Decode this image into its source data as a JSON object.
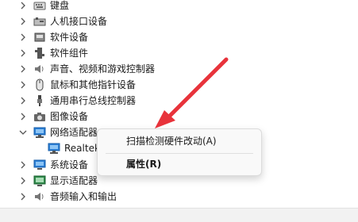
{
  "tree": {
    "items": [
      {
        "label": "键盘",
        "icon": "keyboard-icon"
      },
      {
        "label": "人机接口设备",
        "icon": "hid-icon"
      },
      {
        "label": "软件设备",
        "icon": "software-device-icon"
      },
      {
        "label": "软件组件",
        "icon": "software-component-icon"
      },
      {
        "label": "声音、视频和游戏控制器",
        "icon": "speaker-icon"
      },
      {
        "label": "鼠标和其他指针设备",
        "icon": "mouse-icon"
      },
      {
        "label": "通用串行总线控制器",
        "icon": "usb-icon"
      },
      {
        "label": "图像设备",
        "icon": "camera-icon"
      },
      {
        "label": "网络适配器",
        "icon": "network-adapter-icon",
        "expanded": true
      },
      {
        "label": "Realtek",
        "icon": "network-adapter-icon",
        "child": true
      },
      {
        "label": "系统设备",
        "icon": "system-device-icon"
      },
      {
        "label": "显示适配器",
        "icon": "display-adapter-icon"
      },
      {
        "label": "音频输入和输出",
        "icon": "speaker-icon"
      }
    ]
  },
  "context_menu": {
    "scan_label": "扫描检测硬件改动(A)",
    "properties_label": "属性(R)"
  },
  "colors": {
    "arrow": "#e8333b",
    "accent": "#2b7fd6"
  }
}
